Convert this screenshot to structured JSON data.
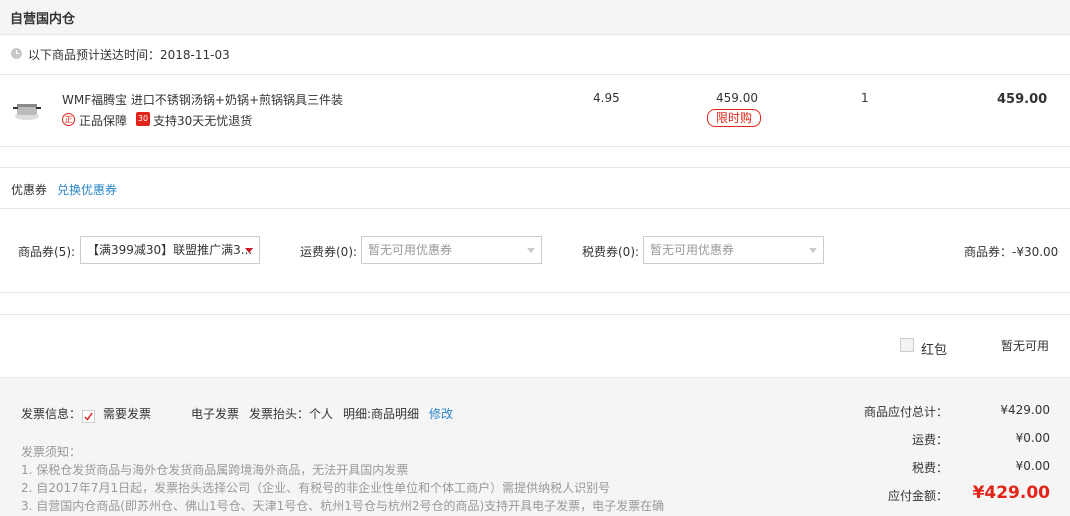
{
  "warehouse_title": "自营国内仓",
  "delivery": {
    "text": "以下商品预计送达时间：2018-11-03"
  },
  "product": {
    "name": "WMF福腾宝 进口不锈钢汤锅+奶锅+煎锅锅具三件装",
    "guarantee_badge": "正",
    "guarantee_label": "正品保障",
    "return_badge": "30",
    "return_label": "支持30天无忧退货",
    "weight": "4.95",
    "price": "459.00",
    "price_tag": "限时购",
    "quantity": "1",
    "subtotal": "459.00"
  },
  "coupon": {
    "label": "优惠券",
    "exchange_link": "兑换优惠券",
    "goods_label": "商品券(5):",
    "goods_value": "【满399减30】联盟推广满3...",
    "shipping_label": "运费券(0):",
    "shipping_value": "暂无可用优惠券",
    "tax_label": "税费券(0):",
    "tax_value": "暂无可用优惠券",
    "discount_summary": "商品券：-¥30.00"
  },
  "redpacket": {
    "label": "红包",
    "status": "暂无可用"
  },
  "invoice": {
    "label": "发票信息：",
    "need_label": "需要发票",
    "type": "电子发票",
    "header": "发票抬头：个人",
    "detail": "明细:商品明细",
    "edit_link": "修改",
    "notice_title": "发票须知：",
    "notes": [
      "1. 保税仓发货商品与海外仓发货商品属跨境海外商品，无法开具国内发票",
      "2. 自2017年7月1日起，发票抬头选择公司（企业、有税号的非企业性单位和个体工商户）需提供纳税人识别号",
      "3. 自营国内仓商品(即苏州仓、佛山1号仓、天津1号仓、杭州1号仓与杭州2号仓的商品)支持开具电子发票，电子发票在确"
    ]
  },
  "summary": {
    "goods_total_label": "商品应付总计：",
    "goods_total_value": "¥429.00",
    "shipping_label": "运费：",
    "shipping_value": "¥0.00",
    "tax_label": "税费：",
    "tax_value": "¥0.00",
    "payable_label": "应付金额：",
    "payable_value": "¥429.00"
  },
  "colors": {
    "accent": "#e2231a",
    "link": "#2a86c8",
    "panel": "#f5f5f5"
  }
}
